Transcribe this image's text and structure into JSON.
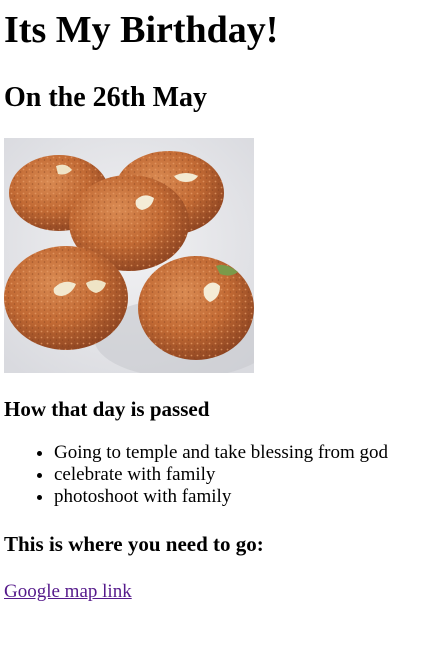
{
  "heading": {
    "title": "Its My Birthday!",
    "subtitle": "On the 26th May"
  },
  "image": {
    "icon": "sweets-photo"
  },
  "day_section": {
    "heading": "How that day is passed",
    "items": [
      "Going to temple and take blessing from god",
      "celebrate with family",
      "photoshoot with family"
    ]
  },
  "where_section": {
    "heading": "This is where you need to go:",
    "link_label": "Google map link"
  },
  "colors": {
    "link": "#551a8b",
    "text": "#000000",
    "background": "#ffffff"
  }
}
